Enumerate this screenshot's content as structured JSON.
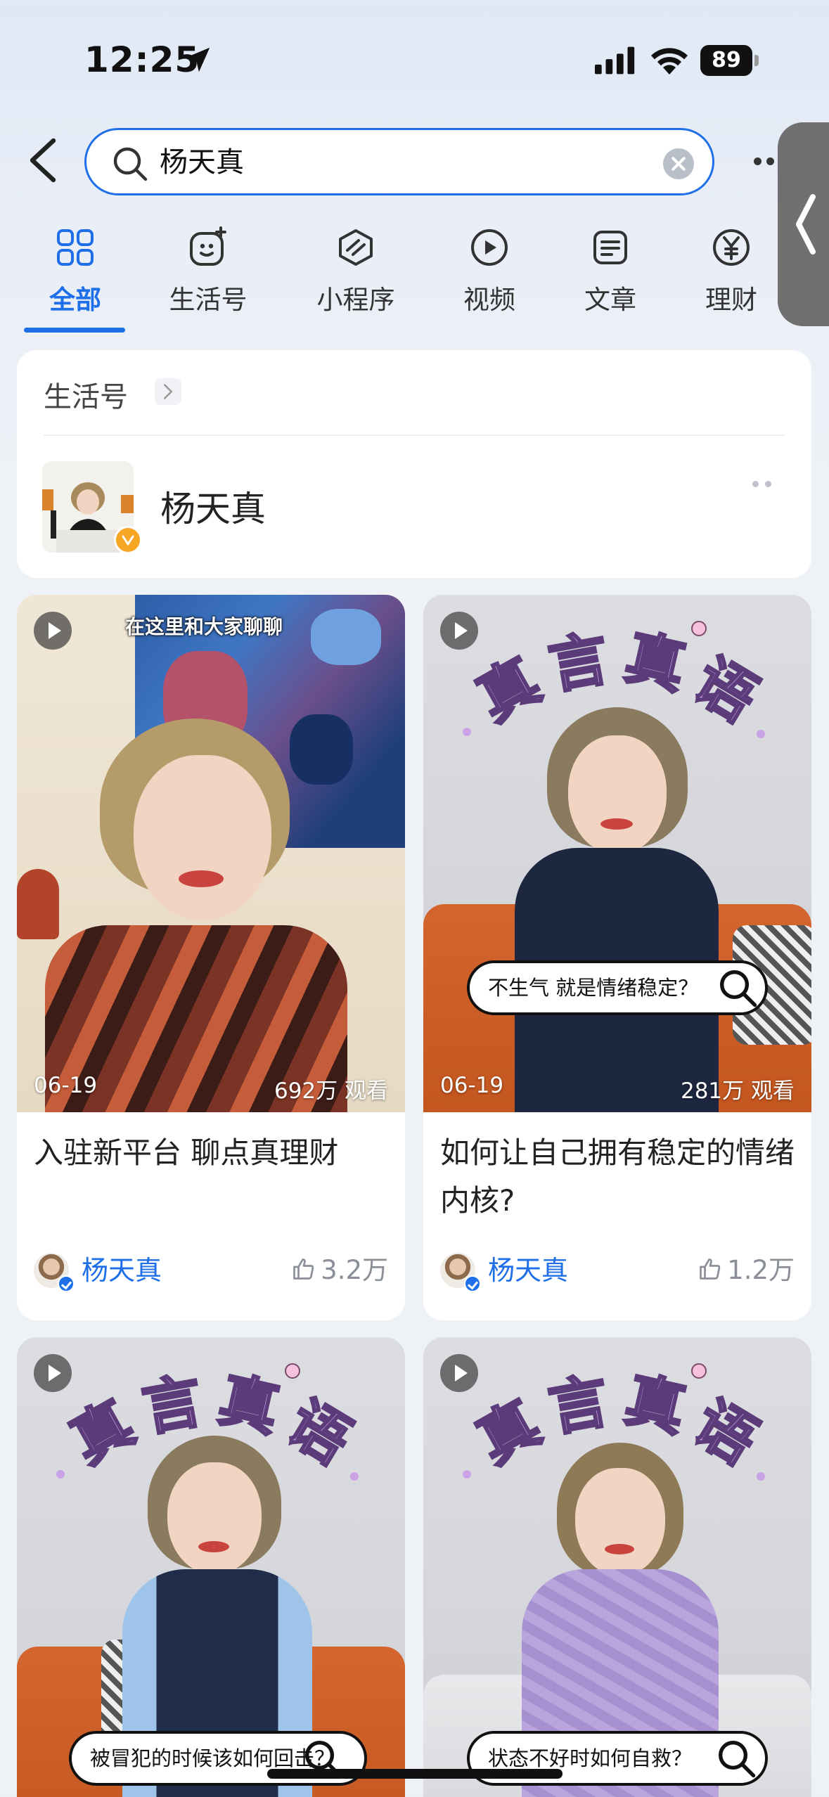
{
  "status_bar": {
    "time": "12:25",
    "battery": "89"
  },
  "search": {
    "query": "杨天真"
  },
  "tabs": [
    {
      "label": "全部",
      "icon": "grid-icon",
      "active": true
    },
    {
      "label": "生活号",
      "icon": "life-account-icon",
      "active": false
    },
    {
      "label": "小程序",
      "icon": "mini-program-icon",
      "active": false
    },
    {
      "label": "视频",
      "icon": "video-icon",
      "active": false
    },
    {
      "label": "文章",
      "icon": "article-icon",
      "active": false
    },
    {
      "label": "理财",
      "icon": "finance-icon",
      "active": false
    }
  ],
  "life_account": {
    "section_title": "生活号",
    "name": "杨天真"
  },
  "videos": [
    {
      "overlay_caption": "在这里和大家聊聊",
      "date": "06-19",
      "views": "692万 观看",
      "title": "入驻新平台 聊点真理财",
      "author": "杨天真",
      "likes": "3.2万"
    },
    {
      "arc_title": "真言真语",
      "bubble_text": "不生气 就是情绪稳定？",
      "date": "06-19",
      "views": "281万 观看",
      "title": "如何让自己拥有稳定的情绪内核?",
      "author": "杨天真",
      "likes": "1.2万"
    },
    {
      "arc_title": "真言真语",
      "bubble_text": "被冒犯的时候该如何回击？"
    },
    {
      "arc_title": "真言真语",
      "bubble_text": "状态不好时如何自救？"
    }
  ],
  "colors": {
    "accent": "#1e6fe8",
    "background": "#eef1f6",
    "arc_text": "#c9a3e6"
  }
}
